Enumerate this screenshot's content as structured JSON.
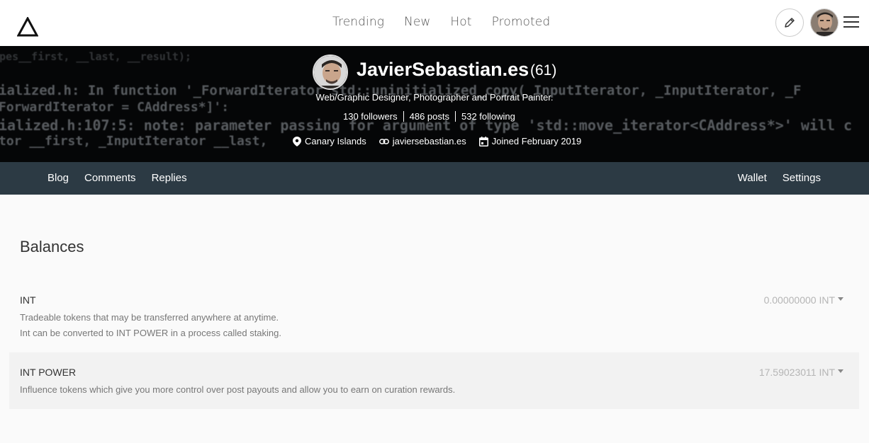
{
  "nav": {
    "links": [
      "Trending",
      "New",
      "Hot",
      "Promoted"
    ]
  },
  "banner": {
    "code_lines": [
      "  ypes__first,    __last,  __result);",
      "ialized.h: In function '_ForwardIterator std::uninitialized_copy(_InputIterator, _InputIterator, _F",
      " ForwardIterator = CAddress*]':",
      "ialized.h:107:5: note: parameter passing for argument of type 'std::move_iterator<CAddress*>' will c",
      "tor __first, _InputIterator __last,"
    ]
  },
  "profile": {
    "name": "JavierSebastian.es",
    "reputation": "(61)",
    "about": "Web/Graphic Designer, Photographer and Portrait Painter.",
    "stats": [
      "130 followers",
      "486 posts",
      "532 following"
    ],
    "location": "Canary Islands",
    "website": "javiersebastian.es",
    "joined": "Joined February 2019"
  },
  "subnav": {
    "left": [
      "Blog",
      "Comments",
      "Replies"
    ],
    "right": [
      "Wallet",
      "Settings"
    ]
  },
  "balances": {
    "title": "Balances",
    "int": {
      "name": "INT",
      "desc1": "Tradeable tokens that may be transferred anywhere at anytime.",
      "desc2": "Int can be converted to INT POWER in a process called staking.",
      "value": "0.00000000 INT"
    },
    "power": {
      "name": "INT POWER",
      "desc1": "Influence tokens which give you more control over post payouts and allow you to earn on curation rewards.",
      "value": "17.59023011 INT"
    }
  },
  "colors": {
    "subnav_bg": "#2c3a44",
    "banner_bg": "#050607"
  }
}
